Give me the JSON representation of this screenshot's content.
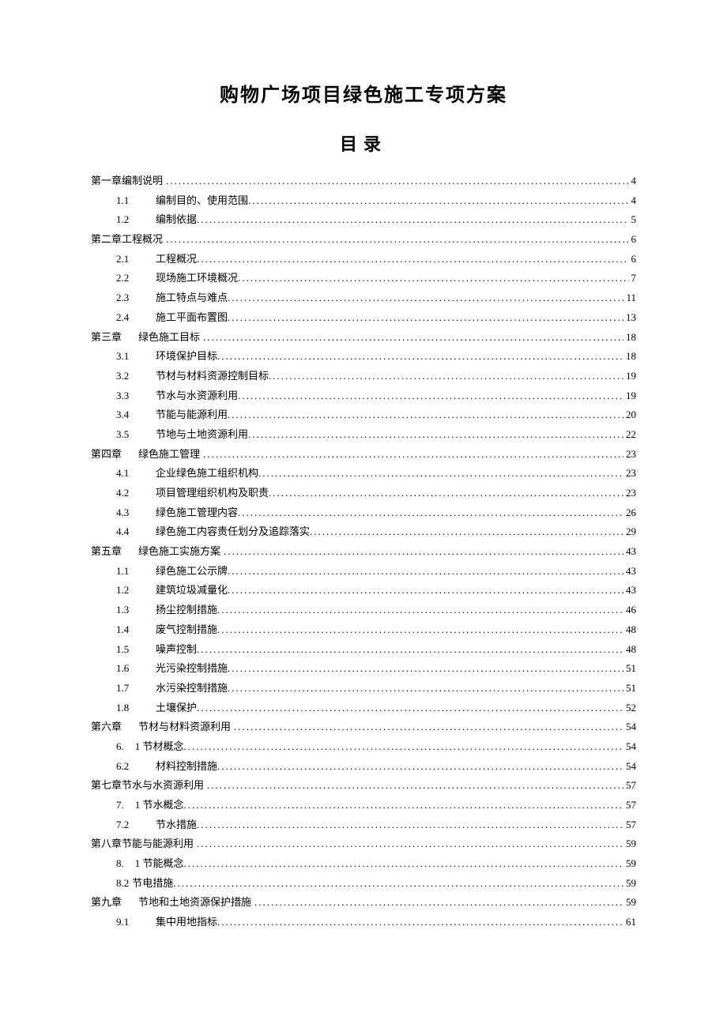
{
  "title": "购物广场项目绿色施工专项方案",
  "subtitle": "目录",
  "toc": [
    {
      "level": 1,
      "num": "第一章",
      "text": "编制说明",
      "page": "4",
      "inline": true
    },
    {
      "level": 2,
      "num": "1.1",
      "text": "编制目的、使用范围",
      "page": "4"
    },
    {
      "level": 2,
      "num": "1.2",
      "text": "编制依据",
      "page": "5"
    },
    {
      "level": 1,
      "num": "第二章",
      "text": "工程概况",
      "page": "6",
      "inline": true
    },
    {
      "level": 2,
      "num": "2.1",
      "text": "工程概况",
      "page": "6"
    },
    {
      "level": 2,
      "num": "2.2",
      "text": "现场施工环境概况",
      "page": "7"
    },
    {
      "level": 2,
      "num": "2.3",
      "text": "施工特点与难点",
      "page": "11"
    },
    {
      "level": 2,
      "num": "2.4",
      "text": "施工平面布置图",
      "page": "13"
    },
    {
      "level": 1,
      "num": "第三章",
      "text": "绿色施工目标",
      "page": "18"
    },
    {
      "level": 2,
      "num": "3.1",
      "text": "环境保护目标",
      "page": "18"
    },
    {
      "level": 2,
      "num": "3.2",
      "text": "节材与材料资源控制目标",
      "page": "19"
    },
    {
      "level": 2,
      "num": "3.3",
      "text": "节水与水资源利用",
      "page": "19"
    },
    {
      "level": 2,
      "num": "3.4",
      "text": "节能与能源利用",
      "page": "20"
    },
    {
      "level": 2,
      "num": "3.5",
      "text": "节地与土地资源利用",
      "page": "22"
    },
    {
      "level": 1,
      "num": "第四章",
      "text": "绿色施工管理",
      "page": "23"
    },
    {
      "level": 2,
      "num": "4.1",
      "text": "企业绿色施工组织机构",
      "page": "23"
    },
    {
      "level": 2,
      "num": "4.2",
      "text": "项目管理组织机构及职责",
      "page": "23"
    },
    {
      "level": 2,
      "num": "4.3",
      "text": "绿色施工管理内容",
      "page": "26"
    },
    {
      "level": 2,
      "num": "4.4",
      "text": "绿色施工内容责任划分及追踪落实",
      "page": "29"
    },
    {
      "level": 1,
      "num": "第五章",
      "text": "绿色施工实施方案",
      "page": "43"
    },
    {
      "level": 2,
      "num": "1.1",
      "text": "绿色施工公示牌",
      "page": "43"
    },
    {
      "level": 2,
      "num": "1.2",
      "text": "建筑垃圾减量化",
      "page": "43"
    },
    {
      "level": 2,
      "num": "1.3",
      "text": "扬尘控制措施",
      "page": "46"
    },
    {
      "level": 2,
      "num": "1.4",
      "text": "废气控制措施",
      "page": "48"
    },
    {
      "level": 2,
      "num": "1.5",
      "text": "噪声控制",
      "page": "48"
    },
    {
      "level": 2,
      "num": "1.6",
      "text": "光污染控制措施",
      "page": "51"
    },
    {
      "level": 2,
      "num": "1.7",
      "text": "水污染控制措施",
      "page": "51"
    },
    {
      "level": 2,
      "num": "1.8",
      "text": "土壤保护",
      "page": "52"
    },
    {
      "level": 1,
      "num": "第六章",
      "text": "节材与材料资源利用",
      "page": "54"
    },
    {
      "level": 2,
      "num": "6.",
      "text": "1 节材概念",
      "page": "54",
      "special": true
    },
    {
      "level": 2,
      "num": "6.2",
      "text": "材料控制措施",
      "page": "54"
    },
    {
      "level": 1,
      "num": "第七章",
      "text": "节水与水资源利用",
      "page": "57",
      "inline": true
    },
    {
      "level": 2,
      "num": "7.",
      "text": "1 节水概念",
      "page": "57",
      "special": true
    },
    {
      "level": 2,
      "num": "7.2",
      "text": "节水措施",
      "page": "57"
    },
    {
      "level": 1,
      "num": "第八章",
      "text": "节能与能源利用",
      "page": "59",
      "inline": true
    },
    {
      "level": 2,
      "num": "8.",
      "text": "1 节能概念",
      "page": "59",
      "special": true
    },
    {
      "level": 2,
      "num": "8.2",
      "text": "节电措施",
      "page": "59",
      "special2": true
    },
    {
      "level": 1,
      "num": "第九章",
      "text": "节地和土地资源保护措施",
      "page": "59"
    },
    {
      "level": 2,
      "num": "9.1",
      "text": "集中用地指标",
      "page": "61"
    }
  ]
}
